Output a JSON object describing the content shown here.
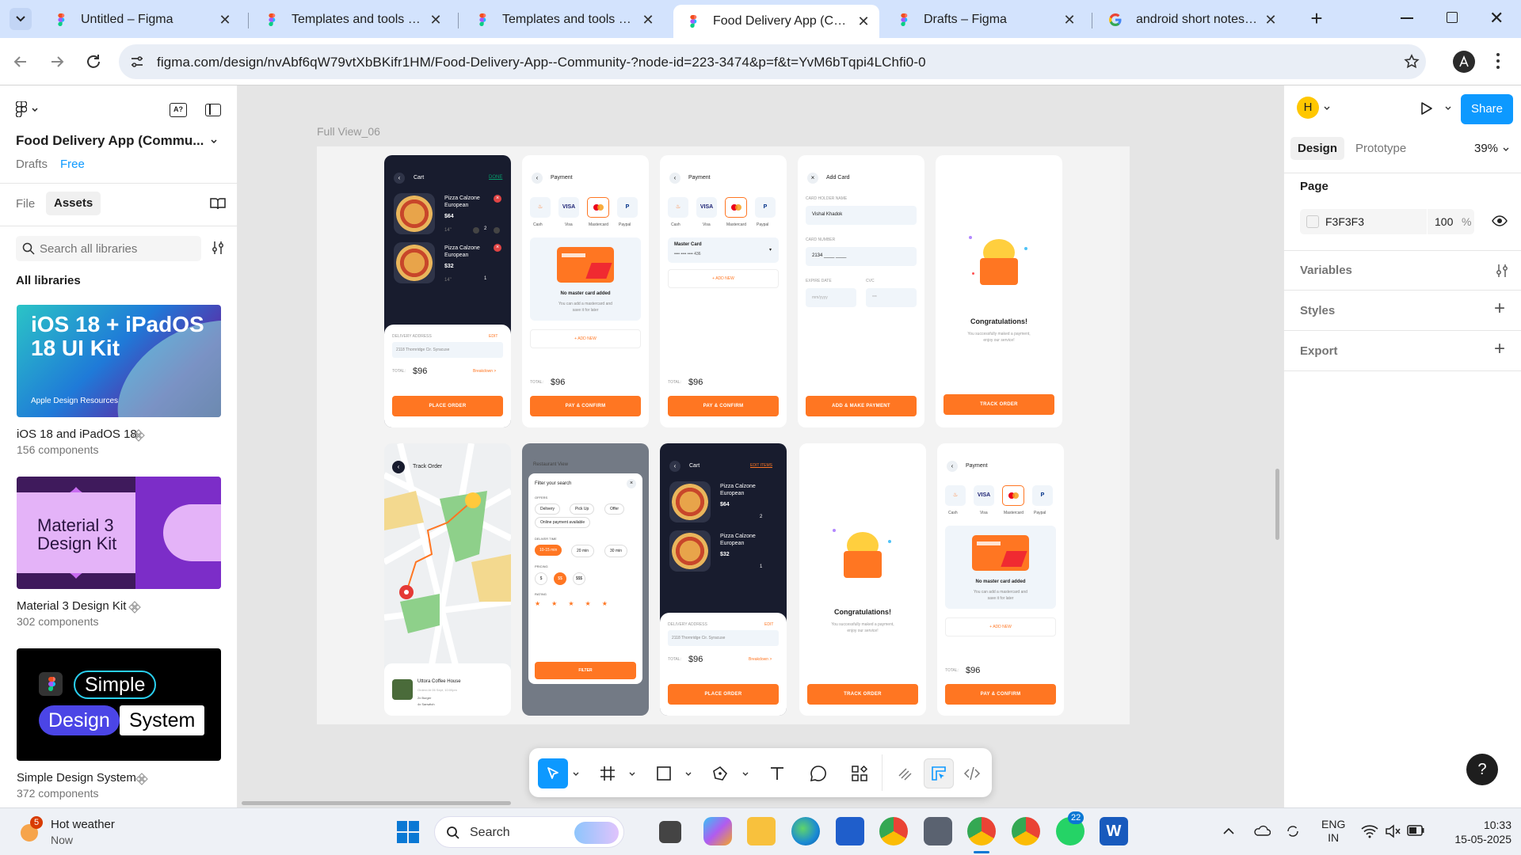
{
  "browser": {
    "tabs": [
      {
        "title": "Untitled – Figma",
        "favicon": "figma-icon"
      },
      {
        "title": "Templates and tools – Figma",
        "favicon": "figma-icon"
      },
      {
        "title": "Templates and tools – Figma",
        "favicon": "figma-icon"
      },
      {
        "title": "Food Delivery App (Community)",
        "favicon": "figma-icon",
        "active": true
      },
      {
        "title": "Drafts – Figma",
        "favicon": "figma-icon"
      },
      {
        "title": "android short notes - Google",
        "favicon": "google-icon"
      }
    ],
    "url": "figma.com/design/nvAbf6qW79vtXbBKifr1HM/Food-Delivery-App--Community-?node-id=223-3474&p=f&t=YvM6bTqpi4LChfi0-0"
  },
  "left_panel": {
    "file_name": "Food Delivery App (Commu...",
    "location": "Drafts",
    "plan_badge": "Free",
    "tabs": [
      "File",
      "Assets"
    ],
    "search_placeholder": "Search all libraries",
    "section_title": "All libraries",
    "libraries": [
      {
        "card_title": "iOS 18 + iPadOS 18 UI Kit",
        "card_caption": "Apple Design Resources",
        "name": "iOS 18 and iPadOS 18",
        "count": "156 components"
      },
      {
        "card_title": "Material 3 Design Kit",
        "name": "Material 3 Design Kit",
        "count": "302 components"
      },
      {
        "card_words": [
          "Simple",
          "Design",
          "System"
        ],
        "name": "Simple Design System",
        "count": "372 components"
      }
    ]
  },
  "canvas": {
    "frame_label": "Full View_06",
    "screens": {
      "cart_title": "Cart",
      "cart_done": "DONE",
      "cart_edit_items": "EDIT ITEMS",
      "item_name_1": "Pizza Calzone",
      "item_name_2": "European",
      "price_1": "$64",
      "price_2": "$32",
      "size": "14\"",
      "qty_1": "2",
      "qty_2": "1",
      "delivery_address_label": "DELIVERY ADDRESS",
      "edit_label": "EDIT",
      "address": "2118 Thornridge Cir. Syracuse",
      "total_label": "TOTAL:",
      "total": "$96",
      "breakdown": "Breakdown >",
      "place_order": "PLACE ORDER",
      "payment_title": "Payment",
      "pay_methods": [
        "Cash",
        "Visa",
        "Mastercard",
        "Paypal"
      ],
      "no_card_title": "No master card added",
      "no_card_desc_1": "You can add a mastercard and",
      "no_card_desc_2": "save it for later",
      "add_new": "+ ADD NEW",
      "pay_confirm": "PAY & CONFIRM",
      "master_card": "Master Card",
      "card_masked": "•••• •••• •••• 436",
      "add_card_title": "Add Card",
      "card_holder_label": "CARD HOLDER NAME",
      "card_holder": "Vishal Khadok",
      "card_number_label": "CARD NUMBER",
      "card_number": "2134 ____ ____",
      "expire_label": "EXPIRE DATE",
      "expire_ph": "mm/yyyy",
      "cvc_label": "CVC",
      "cvc_ph": "***",
      "add_make_payment": "ADD & MAKE PAYMENT",
      "congrats": "Congratulations!",
      "congrats_desc_1": "You successfully maked a payment,",
      "congrats_desc_2": "enjoy our service!",
      "track_order": "TRACK ORDER",
      "track_title": "Track Order",
      "restaurant": "Uttora Coffee House",
      "ordered_at": "Orderd At 06 Sept, 10:00pm",
      "order_items_1": "2x Burger",
      "order_items_2": "4x Sanwitch",
      "filter_title": "Filter your search",
      "offers_label": "OFFERS",
      "offers": [
        "Delivery",
        "Pick Up",
        "Offer",
        "Online payment available"
      ],
      "deliver_time_label": "DELIVER TIME",
      "times": [
        "10-15 min",
        "20 min",
        "30 min"
      ],
      "pricing_label": "PRICING",
      "prices": [
        "$",
        "$$",
        "$$$"
      ],
      "rating_label": "RATING",
      "filter_btn": "FILTER",
      "restaurant_view": "Restaurant View"
    }
  },
  "right_panel": {
    "avatar_letter": "H",
    "share": "Share",
    "tabs": [
      "Design",
      "Prototype"
    ],
    "zoom": "39%",
    "page_label": "Page",
    "page_color": "F3F3F3",
    "page_opacity": "100",
    "percent": "%",
    "variables": "Variables",
    "styles": "Styles",
    "export": "Export",
    "help": "?"
  },
  "taskbar": {
    "weather_badge": "5",
    "weather_title": "Hot weather",
    "weather_sub": "Now",
    "search": "Search",
    "whatsapp_badge": "22",
    "lang_1": "ENG",
    "lang_2": "IN",
    "time": "10:33",
    "date": "15-05-2025"
  },
  "colors": {
    "accent": "#0d99ff",
    "brand_orange": "#ff7622",
    "dark": "#181c2e"
  }
}
